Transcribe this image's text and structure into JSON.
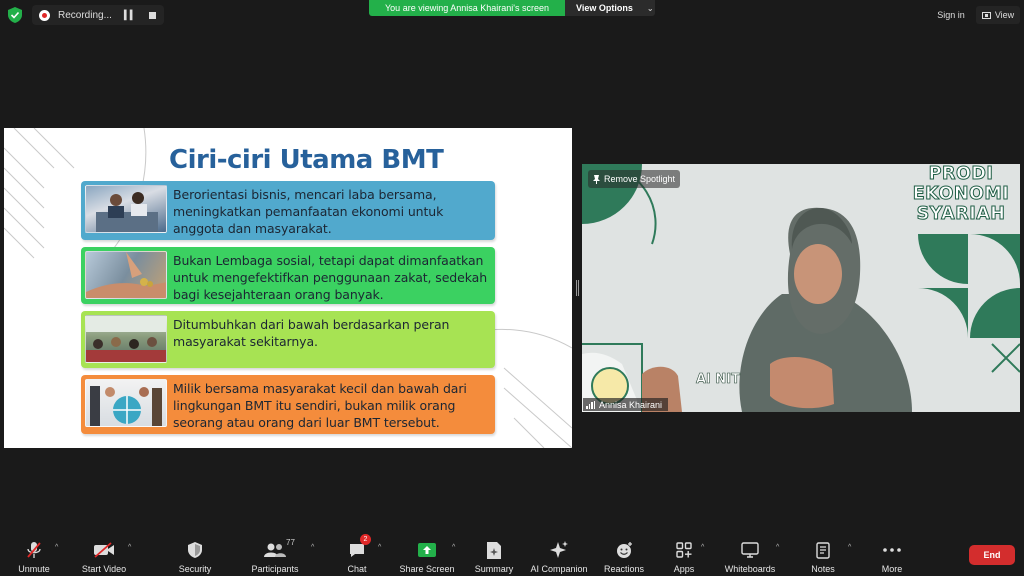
{
  "recording": {
    "label": "Recording..."
  },
  "banner": {
    "viewing": "You are viewing Annisa Khairani's screen",
    "view_options": "View Options"
  },
  "topright": {
    "sign_in": "Sign in",
    "view": "View"
  },
  "slide": {
    "title": "Ciri-ciri Utama BMT",
    "points": [
      {
        "text": "Berorientasi bisnis, mencari laba bersama, meningkatkan pemanfaatan ekonomi untuk anggota dan masyarakat."
      },
      {
        "text": "Bukan Lembaga sosial, tetapi dapat dimanfaatkan untuk mengefektifkan penggunaan zakat, sedekah bagi kesejahteraan orang banyak."
      },
      {
        "text": "Ditumbuhkan dari bawah berdasarkan peran masyarakat sekitarnya."
      },
      {
        "text": "Milik bersama masyarakat kecil dan bawah dari lingkungan BMT itu sendiri, bukan milik orang seorang atau orang dari luar BMT tersebut."
      }
    ]
  },
  "video": {
    "remove_spotlight": "Remove Spotlight",
    "participant_name": "Annisa Khairani",
    "background_text": [
      "PRODI",
      "EKONOMI",
      "SYARIAH"
    ],
    "logo_text": "AI NIT"
  },
  "toolbar": {
    "unmute": "Unmute",
    "start_video": "Start Video",
    "security": "Security",
    "participants": "Participants",
    "participants_count": "77",
    "chat": "Chat",
    "chat_badge": "2",
    "share_screen": "Share Screen",
    "summary": "Summary",
    "ai_companion": "AI Companion",
    "reactions": "Reactions",
    "apps": "Apps",
    "whiteboards": "Whiteboards",
    "notes": "Notes",
    "more": "More",
    "end": "End"
  },
  "colors": {
    "share_green": "#23b04a",
    "end_red": "#d32d2d",
    "title_blue": "#27619b",
    "point1": "#51a9cd",
    "point2": "#3bd161",
    "point3": "#a7e353",
    "point4": "#f48c3c"
  }
}
